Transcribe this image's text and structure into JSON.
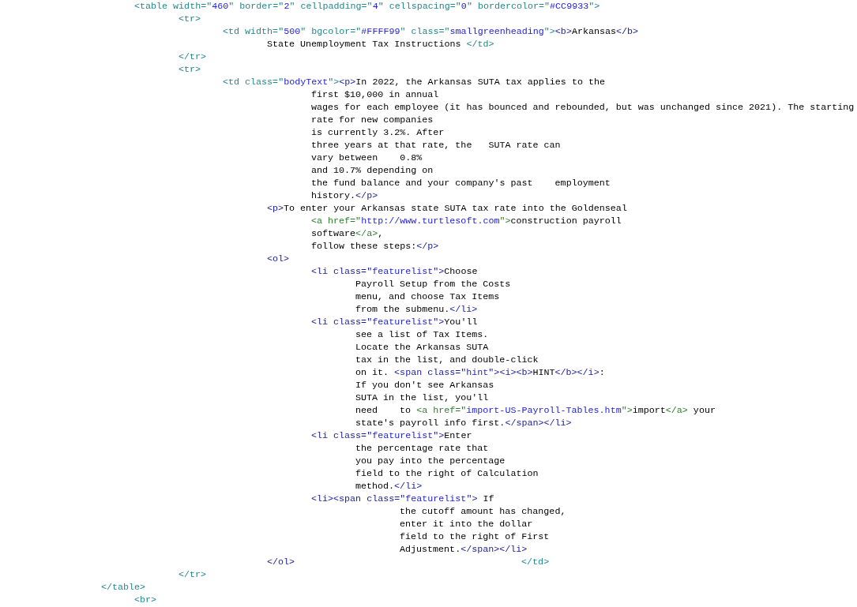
{
  "source_lines": [
    {
      "segments": [
        {
          "kind": "table",
          "text": "<table width=\""
        },
        {
          "kind": "value",
          "text": "460"
        },
        {
          "kind": "table",
          "text": "\" border=\""
        },
        {
          "kind": "value",
          "text": "2"
        },
        {
          "kind": "table",
          "text": "\" cellpadding=\""
        },
        {
          "kind": "value",
          "text": "4"
        },
        {
          "kind": "table",
          "text": "\" cellspacing=\""
        },
        {
          "kind": "value",
          "text": "0"
        },
        {
          "kind": "table",
          "text": "\" bordercolor=\""
        },
        {
          "kind": "value",
          "text": "#CC9933"
        },
        {
          "kind": "table",
          "text": "\">"
        }
      ]
    },
    {
      "segments": [
        {
          "kind": "table",
          "text": "<tr>"
        }
      ]
    },
    {
      "segments": [
        {
          "kind": "table",
          "text": "<td width=\""
        },
        {
          "kind": "value",
          "text": "500"
        },
        {
          "kind": "table",
          "text": "\" bgcolor=\""
        },
        {
          "kind": "value",
          "text": "#FFFF99"
        },
        {
          "kind": "table",
          "text": "\" class=\""
        },
        {
          "kind": "value",
          "text": "smallgreenheading"
        },
        {
          "kind": "table",
          "text": "\">"
        },
        {
          "kind": "markup",
          "text": "<b>"
        },
        {
          "kind": "text",
          "text": "Arkansas"
        },
        {
          "kind": "markup",
          "text": "</b>"
        }
      ]
    },
    {
      "segments": [
        {
          "kind": "text",
          "text": "State Unemployment Tax Instructions "
        },
        {
          "kind": "table",
          "text": "</td>"
        }
      ]
    },
    {
      "segments": [
        {
          "kind": "table",
          "text": "</tr>"
        }
      ]
    },
    {
      "segments": [
        {
          "kind": "table",
          "text": "<tr>"
        }
      ]
    },
    {
      "segments": [
        {
          "kind": "table",
          "text": "<td class=\""
        },
        {
          "kind": "value",
          "text": "bodyText"
        },
        {
          "kind": "table",
          "text": "\">"
        },
        {
          "kind": "markup",
          "text": "<p>"
        },
        {
          "kind": "text",
          "text": "In 2022, the Arkansas SUTA tax applies to the"
        }
      ]
    },
    {
      "segments": [
        {
          "kind": "text",
          "text": "first $10,000 in annual"
        }
      ]
    },
    {
      "segments": [
        {
          "kind": "text",
          "text": "wages for each employee (it has bounced and rebounded, but was unchanged since 2021). The starting"
        }
      ]
    },
    {
      "segments": [
        {
          "kind": "text",
          "text": "rate for new companies"
        }
      ]
    },
    {
      "segments": [
        {
          "kind": "text",
          "text": "is currently 3.2%. After"
        }
      ]
    },
    {
      "segments": [
        {
          "kind": "text",
          "text": "three years at that rate, the   SUTA rate can"
        }
      ]
    },
    {
      "segments": [
        {
          "kind": "text",
          "text": "vary between    0.8%"
        }
      ]
    },
    {
      "segments": [
        {
          "kind": "text",
          "text": "and 10.7% depending on"
        }
      ]
    },
    {
      "segments": [
        {
          "kind": "text",
          "text": "the fund balance and your company's past    employment"
        }
      ]
    },
    {
      "segments": [
        {
          "kind": "text",
          "text": "history."
        },
        {
          "kind": "markup",
          "text": "</p>"
        }
      ]
    },
    {
      "segments": [
        {
          "kind": "markup",
          "text": "<p>"
        },
        {
          "kind": "text",
          "text": "To enter your Arkansas state SUTA tax rate into the Goldenseal"
        }
      ]
    },
    {
      "segments": [
        {
          "kind": "link",
          "text": "<a href=\""
        },
        {
          "kind": "value",
          "text": "http://www.turtlesoft.com"
        },
        {
          "kind": "link",
          "text": "\">"
        },
        {
          "kind": "text",
          "text": "construction payroll"
        }
      ]
    },
    {
      "segments": [
        {
          "kind": "text",
          "text": "software"
        },
        {
          "kind": "link",
          "text": "</a>"
        },
        {
          "kind": "text",
          "text": ","
        }
      ]
    },
    {
      "segments": [
        {
          "kind": "text",
          "text": "follow these steps:"
        },
        {
          "kind": "markup",
          "text": "</p>"
        }
      ]
    },
    {
      "segments": [
        {
          "kind": "markup",
          "text": "<ol>"
        }
      ]
    },
    {
      "segments": [
        {
          "kind": "markup",
          "text": "<li class=\""
        },
        {
          "kind": "value",
          "text": "featurelist"
        },
        {
          "kind": "markup",
          "text": "\">"
        },
        {
          "kind": "text",
          "text": "Choose"
        }
      ]
    },
    {
      "segments": [
        {
          "kind": "text",
          "text": "Payroll Setup from the Costs"
        }
      ]
    },
    {
      "segments": [
        {
          "kind": "text",
          "text": "menu, and choose Tax Items"
        }
      ]
    },
    {
      "segments": [
        {
          "kind": "text",
          "text": "from the submenu."
        },
        {
          "kind": "markup",
          "text": "</li>"
        }
      ]
    },
    {
      "segments": [
        {
          "kind": "markup",
          "text": "<li class=\""
        },
        {
          "kind": "value",
          "text": "featurelist"
        },
        {
          "kind": "markup",
          "text": "\">"
        },
        {
          "kind": "text",
          "text": "You'll"
        }
      ]
    },
    {
      "segments": [
        {
          "kind": "text",
          "text": "see a list of Tax Items."
        }
      ]
    },
    {
      "segments": [
        {
          "kind": "text",
          "text": "Locate the Arkansas SUTA"
        }
      ]
    },
    {
      "segments": [
        {
          "kind": "text",
          "text": "tax in the list, and double-click"
        }
      ]
    },
    {
      "segments": [
        {
          "kind": "text",
          "text": "on it. "
        },
        {
          "kind": "markup",
          "text": "<span class=\""
        },
        {
          "kind": "value",
          "text": "hint"
        },
        {
          "kind": "markup",
          "text": "\"><i><b>"
        },
        {
          "kind": "text",
          "text": "HINT"
        },
        {
          "kind": "markup",
          "text": "</b></i>"
        },
        {
          "kind": "text",
          "text": ":"
        }
      ]
    },
    {
      "segments": [
        {
          "kind": "text",
          "text": "If you don't see Arkansas"
        }
      ]
    },
    {
      "segments": [
        {
          "kind": "text",
          "text": "SUTA in the list, you'll"
        }
      ]
    },
    {
      "segments": [
        {
          "kind": "text",
          "text": "need    to "
        },
        {
          "kind": "link",
          "text": "<a href=\""
        },
        {
          "kind": "value",
          "text": "import-US-Payroll-Tables.htm"
        },
        {
          "kind": "link",
          "text": "\">"
        },
        {
          "kind": "text",
          "text": "import"
        },
        {
          "kind": "link",
          "text": "</a>"
        },
        {
          "kind": "text",
          "text": " your"
        }
      ]
    },
    {
      "segments": [
        {
          "kind": "text",
          "text": "state's payroll info first."
        },
        {
          "kind": "markup",
          "text": "</span></li>"
        }
      ]
    },
    {
      "segments": [
        {
          "kind": "markup",
          "text": "<li class=\""
        },
        {
          "kind": "value",
          "text": "featurelist"
        },
        {
          "kind": "markup",
          "text": "\">"
        },
        {
          "kind": "text",
          "text": "Enter"
        }
      ]
    },
    {
      "segments": [
        {
          "kind": "text",
          "text": "the percentage rate that"
        }
      ]
    },
    {
      "segments": [
        {
          "kind": "text",
          "text": "you pay into the percentage"
        }
      ]
    },
    {
      "segments": [
        {
          "kind": "text",
          "text": "field to the right of Calculation"
        }
      ]
    },
    {
      "segments": [
        {
          "kind": "text",
          "text": "method."
        },
        {
          "kind": "markup",
          "text": "</li>"
        }
      ]
    },
    {
      "segments": [
        {
          "kind": "markup",
          "text": "<li><span class=\""
        },
        {
          "kind": "value",
          "text": "featurelist"
        },
        {
          "kind": "markup",
          "text": "\">"
        },
        {
          "kind": "text",
          "text": " If"
        }
      ]
    },
    {
      "segments": [
        {
          "kind": "text",
          "text": "the cutoff amount has changed,"
        }
      ]
    },
    {
      "segments": [
        {
          "kind": "text",
          "text": "enter it into the dollar"
        }
      ]
    },
    {
      "segments": [
        {
          "kind": "text",
          "text": "field to the right of First"
        }
      ]
    },
    {
      "segments": [
        {
          "kind": "text",
          "text": "Adjustment."
        },
        {
          "kind": "markup",
          "text": "</span></li>"
        }
      ]
    },
    {
      "segments": [
        {
          "kind": "markup",
          "text": "</ol>"
        },
        {
          "kind": "table",
          "text": "</td>"
        }
      ]
    },
    {
      "segments": [
        {
          "kind": "table",
          "text": "</tr>"
        }
      ]
    },
    {
      "segments": [
        {
          "kind": "table",
          "text": "</table>"
        }
      ]
    },
    {
      "segments": [
        {
          "kind": "table",
          "text": "<br>"
        }
      ]
    }
  ]
}
